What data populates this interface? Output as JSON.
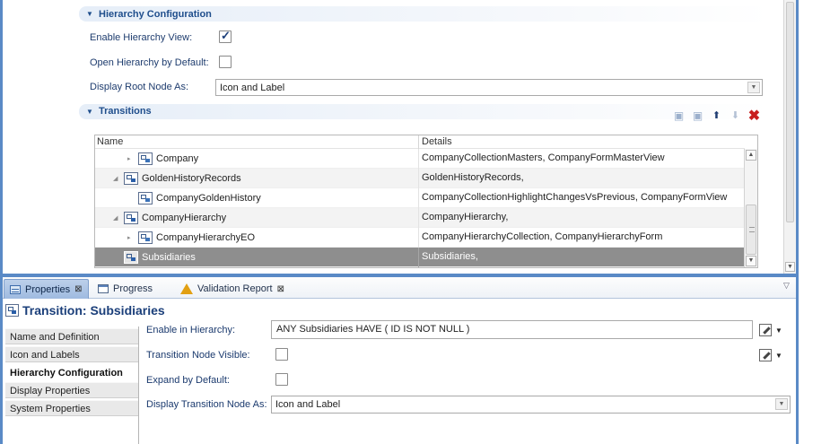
{
  "editor": {
    "hierarchy_section": {
      "title": "Hierarchy Configuration",
      "enable_label": "Enable Hierarchy View:",
      "enable_checked": true,
      "open_label": "Open Hierarchy by Default:",
      "open_checked": false,
      "root_label": "Display Root Node As:",
      "root_value": "Icon and Label"
    },
    "transitions_section": {
      "title": "Transitions",
      "toolbar": [
        "add-transition-icon",
        "edit-transition-icon",
        "move-up-icon",
        "move-down-icon",
        "delete-icon"
      ],
      "columns": {
        "name": "Name",
        "details": "Details"
      },
      "rows": [
        {
          "name": "Company",
          "details": "CompanyCollectionMasters, CompanyFormMasterView",
          "expander": "▸",
          "icon": "entity-icon"
        },
        {
          "name": "GoldenHistoryRecords",
          "details": "GoldenHistoryRecords,",
          "expander": "◢",
          "icon": "transition-icon"
        },
        {
          "name": "CompanyGoldenHistory",
          "details": "CompanyCollectionHighlightChangesVsPrevious, CompanyFormView",
          "expander": "",
          "icon": "entity-icon"
        },
        {
          "name": "CompanyHierarchy",
          "details": "CompanyHierarchy,",
          "expander": "◢",
          "icon": "transition-icon"
        },
        {
          "name": "CompanyHierarchyEO",
          "details": "CompanyHierarchyCollection, CompanyHierarchyForm",
          "expander": "▸",
          "icon": "entity-icon"
        },
        {
          "name": "Subsidiaries",
          "details": "Subsidiaries,",
          "expander": "",
          "icon": "transition-icon",
          "selected": true
        }
      ]
    }
  },
  "tabs": [
    {
      "label": "Properties",
      "icon": "properties-icon",
      "closable": true,
      "active": true
    },
    {
      "label": "Progress",
      "icon": "progress-icon",
      "closable": false,
      "active": false
    },
    {
      "label": "Validation Report",
      "icon": "warning-icon",
      "closable": true,
      "active": false
    }
  ],
  "properties": {
    "title": "Transition: Subsidiaries",
    "sidebar": [
      {
        "label": "Name and Definition",
        "active": false
      },
      {
        "label": "Icon and Labels",
        "active": false
      },
      {
        "label": "Hierarchy Configuration",
        "active": true
      },
      {
        "label": "Display Properties",
        "active": false
      },
      {
        "label": "System Properties",
        "active": false
      }
    ],
    "fields": {
      "enable_in_hierarchy_label": "Enable in Hierarchy:",
      "enable_in_hierarchy_value": "ANY Subsidiaries HAVE ( ID IS NOT NULL )",
      "node_visible_label": "Transition Node Visible:",
      "node_visible_checked": false,
      "expand_default_label": "Expand by Default:",
      "expand_default_checked": false,
      "display_node_label": "Display Transition Node As:",
      "display_node_value": "Icon and Label"
    }
  },
  "colors": {
    "frame": "#5a8ac6",
    "section_title": "#1f4e8c",
    "selected_row": "#8e8e8e",
    "delete": "#c81e1e"
  }
}
